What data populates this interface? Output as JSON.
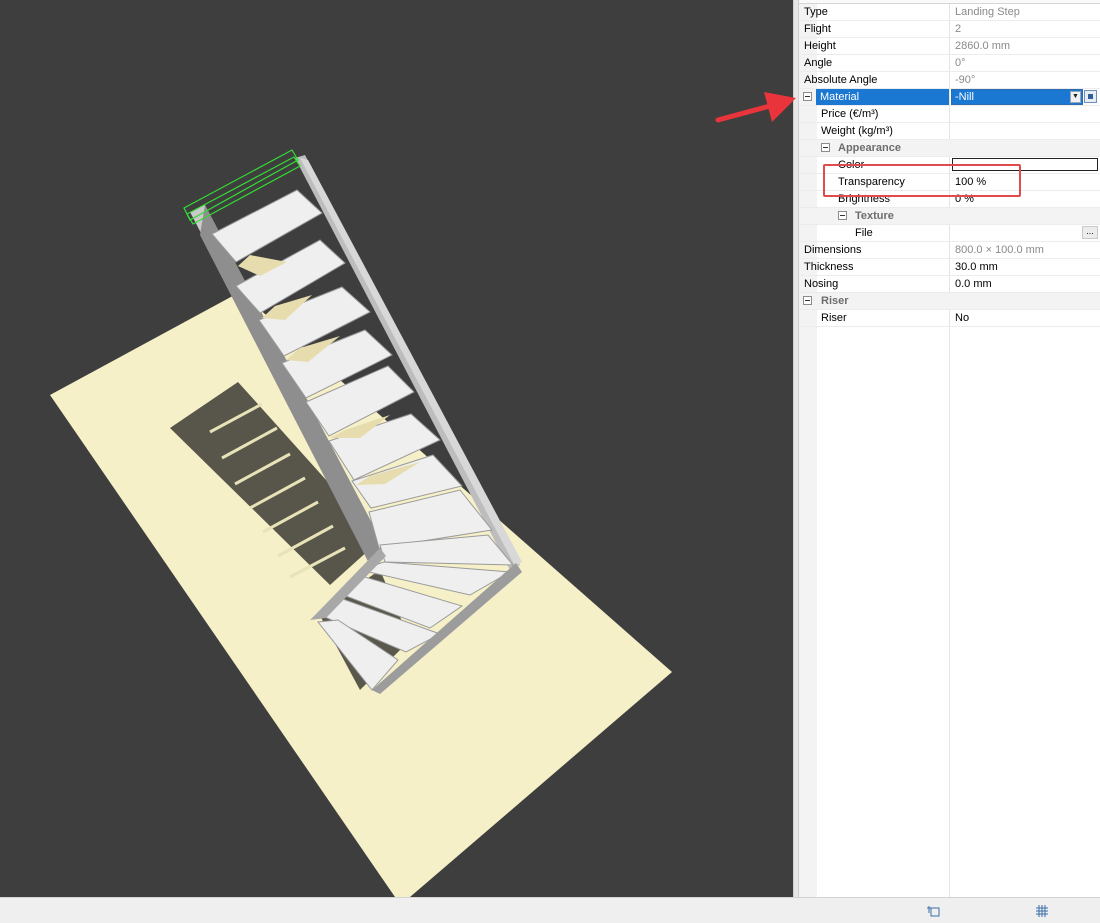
{
  "properties": {
    "type": {
      "label": "Type",
      "value": "Landing Step"
    },
    "flight": {
      "label": "Flight",
      "value": "2"
    },
    "height": {
      "label": "Height",
      "value": "2860.0 mm"
    },
    "angle": {
      "label": "Angle",
      "value": "0°"
    },
    "absolute_angle": {
      "label": "Absolute Angle",
      "value": "-90°"
    },
    "material": {
      "label": "Material",
      "value": "-Nill"
    },
    "price": {
      "label": "Price (€/m³)",
      "value": ""
    },
    "weight": {
      "label": "Weight (kg/m³)",
      "value": ""
    },
    "appearance": {
      "label": "Appearance"
    },
    "color": {
      "label": "Color",
      "value": ""
    },
    "transparency": {
      "label": "Transparency",
      "value": "100 %"
    },
    "brightness": {
      "label": "Brightness",
      "value": "0 %"
    },
    "texture": {
      "label": "Texture"
    },
    "file": {
      "label": "File",
      "value": "",
      "button": "..."
    },
    "dimensions": {
      "label": "Dimensions",
      "value": "800.0 × 100.0 mm"
    },
    "thickness": {
      "label": "Thickness",
      "value": "30.0 mm"
    },
    "nosing": {
      "label": "Nosing",
      "value": "0.0 mm"
    },
    "riser_cat": {
      "label": "Riser"
    },
    "riser": {
      "label": "Riser",
      "value": "No"
    }
  },
  "colors": {
    "viewport_bg": "#3e3e3e",
    "floor": "#f5f0c8",
    "selection_blue": "#1a77d2",
    "highlight_red": "#e04b4b",
    "selection_outline": "#33dd33"
  },
  "icons": [
    "collapse-icon",
    "dropdown-arrow-icon",
    "material-picker-icon",
    "browse-ellipsis-icon",
    "annotation-arrow-icon",
    "snap-icon",
    "grid-icon"
  ]
}
